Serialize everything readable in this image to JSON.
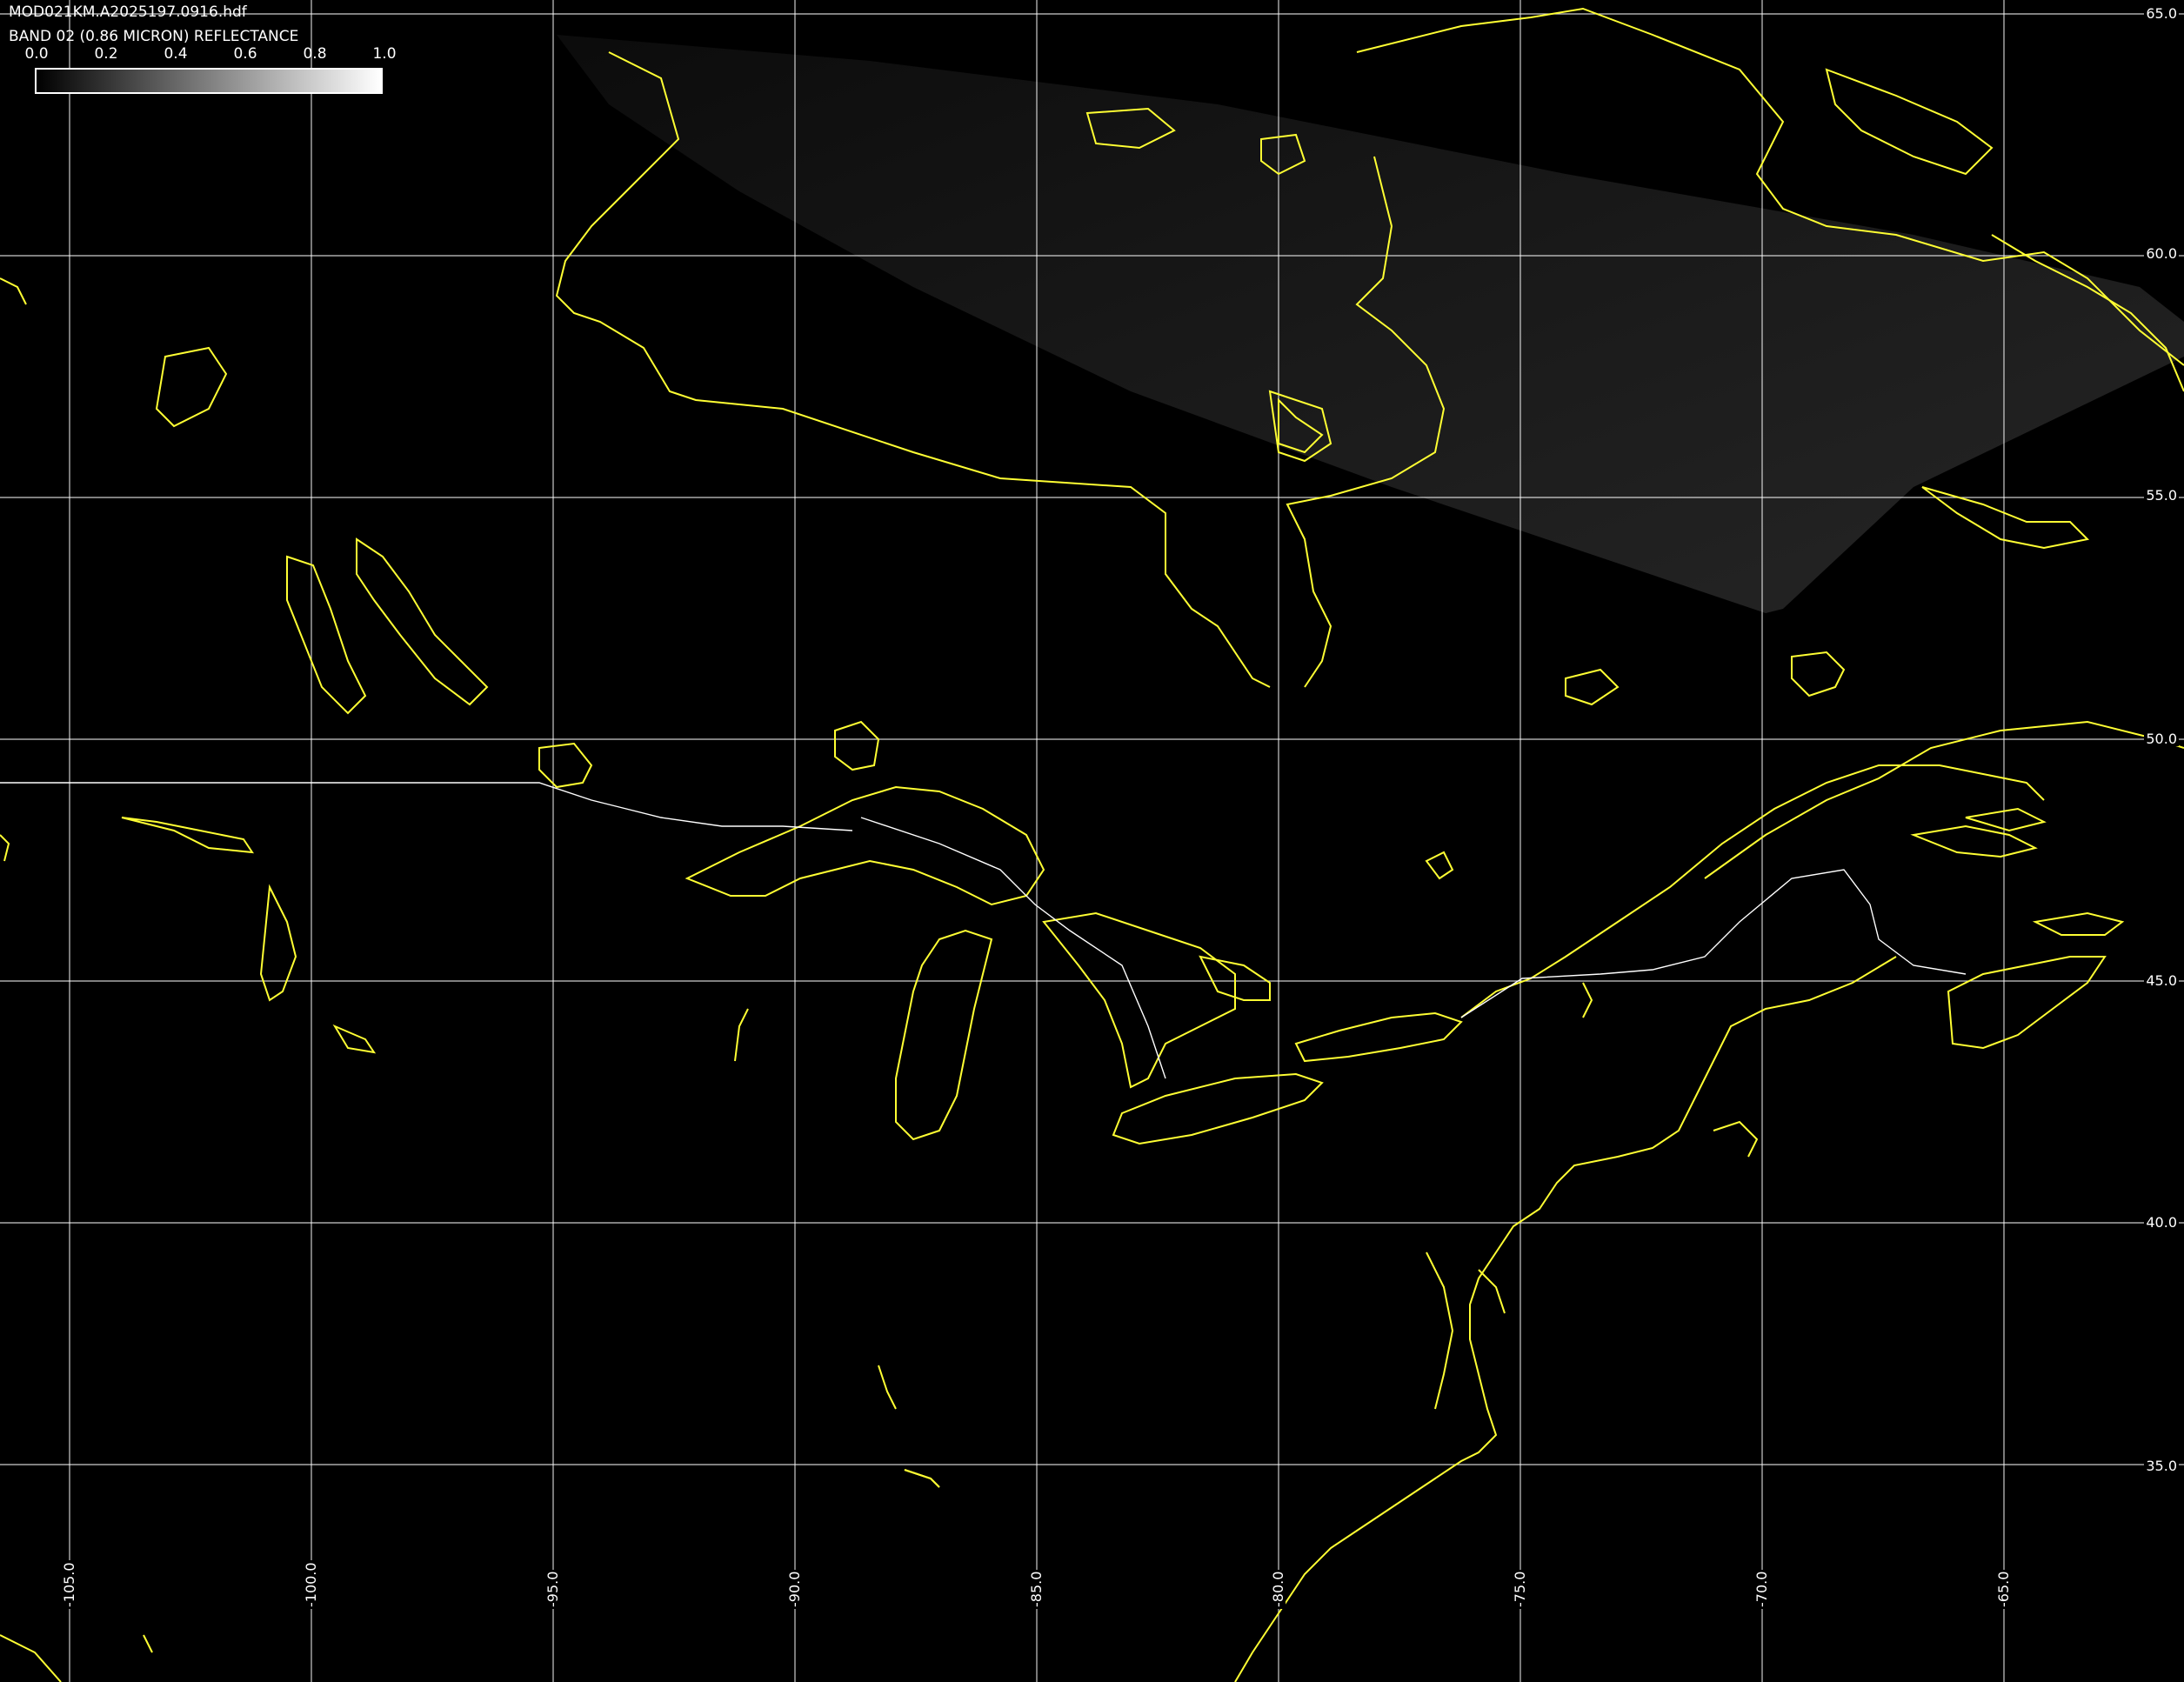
{
  "header": {
    "file_name": "MOD021KM.A2025197.0916.hdf",
    "band_title": "BAND 02 (0.86 MICRON) REFLECTANCE"
  },
  "colorbar": {
    "ticks": [
      "0.0",
      "0.2",
      "0.4",
      "0.6",
      "0.8",
      "1.0"
    ],
    "min": 0.0,
    "max": 1.0,
    "color_low": "#000000",
    "color_high": "#ffffff"
  },
  "grid": {
    "latitudes": [
      {
        "value": 65,
        "label": "65.0"
      },
      {
        "value": 60,
        "label": "60.0"
      },
      {
        "value": 55,
        "label": "55.0"
      },
      {
        "value": 50,
        "label": "50.0"
      },
      {
        "value": 45,
        "label": "45.0"
      },
      {
        "value": 40,
        "label": "40.0"
      },
      {
        "value": 35,
        "label": "35.0"
      }
    ],
    "longitudes": [
      {
        "value": -105,
        "label": "-105.0"
      },
      {
        "value": -100,
        "label": "-100.0"
      },
      {
        "value": -95,
        "label": "-95.0"
      },
      {
        "value": -90,
        "label": "-90.0"
      },
      {
        "value": -85,
        "label": "-85.0"
      },
      {
        "value": -80,
        "label": "-80.0"
      },
      {
        "value": -75,
        "label": "-75.0"
      },
      {
        "value": -70,
        "label": "-70.0"
      },
      {
        "value": -65,
        "label": "-65.0"
      }
    ],
    "line_color": "#ffffff"
  },
  "overlay": {
    "coastline_color": "#ffff33",
    "border_color": "#ffffff"
  }
}
